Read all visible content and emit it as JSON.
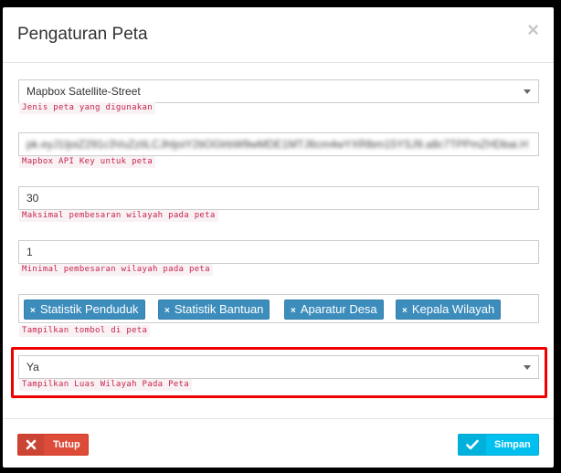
{
  "modal": {
    "title": "Pengaturan Peta",
    "close_symbol": "×"
  },
  "fields": {
    "map_type": {
      "value": "Mapbox Satellite-Street",
      "help": "Jenis peta yang digunakan"
    },
    "api_key": {
      "value": "pk.eyJ1IjoiZ291c3VuZzIiLCJhIjoiY2tiOGlrbW9wMDE1MTJ6cm4wYXRlbm15YSJ9.a8c7TPPmZHDbai.HzZa.C",
      "help": "Mapbox API Key untuk peta"
    },
    "max_zoom": {
      "value": "30",
      "help": "Maksimal pembesaran wilayah pada peta"
    },
    "min_zoom": {
      "value": "1",
      "help": "Minimal pembesaran wilayah pada peta"
    },
    "buttons": {
      "tags": [
        {
          "label": "Statistik Penduduk",
          "remove": "×"
        },
        {
          "label": "Statistik Bantuan",
          "remove": "×"
        },
        {
          "label": "Aparatur Desa",
          "remove": "×"
        },
        {
          "label": "Kepala Wilayah",
          "remove": "×"
        }
      ],
      "help": "Tampilkan tombol di peta"
    },
    "show_area": {
      "value": "Ya",
      "help": "Tampilkan Luas Wilayah Pada Peta"
    }
  },
  "footer": {
    "close_label": "Tutup",
    "save_label": "Simpan"
  },
  "colors": {
    "highlight": "#e00000",
    "tag": "#3c8dbc",
    "danger": "#dd4b39",
    "info": "#00c0ef",
    "help_text": "#c7254e"
  },
  "icons": {
    "close_button": "times-icon",
    "save_button": "check-icon",
    "select": "caret-down-icon"
  }
}
